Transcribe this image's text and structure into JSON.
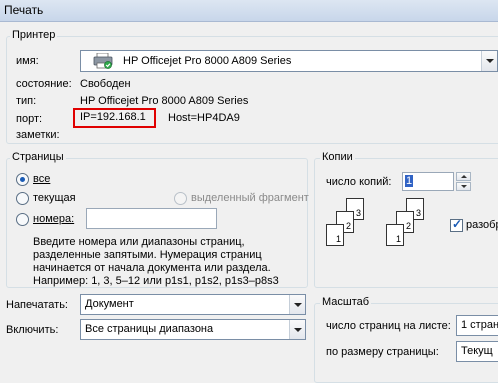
{
  "window": {
    "title": "Печать"
  },
  "printer": {
    "group_title": "Принтер",
    "name_label": "имя:",
    "name_value": "HP Officejet Pro 8000 A809 Series",
    "status_label": "состояние:",
    "status_value": "Свободен",
    "type_label": "тип:",
    "type_value": "HP Officejet Pro 8000 A809 Series",
    "port_label": "порт:",
    "port_value": "IP=192.168.1",
    "port_host": "Host=HP4DA9",
    "notes_label": "заметки:",
    "port_highlight_color": "#e00000"
  },
  "pages": {
    "group_title": "Страницы",
    "all_label": "все",
    "current_label": "текущая",
    "selection_label": "выделенный фрагмент",
    "pages_label": "номера:",
    "pages_value": "",
    "hint_line1": "Введите номера или диапазоны страниц,",
    "hint_line2": "разделенные запятыми. Нумерация страниц",
    "hint_line3": "начинается от начала документа или раздела.",
    "hint_line4": "Например: 1, 3, 5–12 или p1s1, p1s2, p1s3–p8s3"
  },
  "copies": {
    "group_title": "Копии",
    "count_label": "число копий:",
    "count_value": "1",
    "collate_label": "разобр",
    "collate_checked": true,
    "stack1": [
      "1",
      "2",
      "3"
    ],
    "stack2": [
      "1",
      "2",
      "3"
    ]
  },
  "print_what": {
    "label": "Напечатать:",
    "value": "Документ"
  },
  "include": {
    "label": "Включить:",
    "value": "Все страницы диапазона"
  },
  "zoom": {
    "group_title": "Масштаб",
    "pages_per_sheet_label": "число страниц на листе:",
    "pages_per_sheet_value": "1 стран",
    "scale_to_label": "по размеру страницы:",
    "scale_to_value": "Текущ"
  }
}
